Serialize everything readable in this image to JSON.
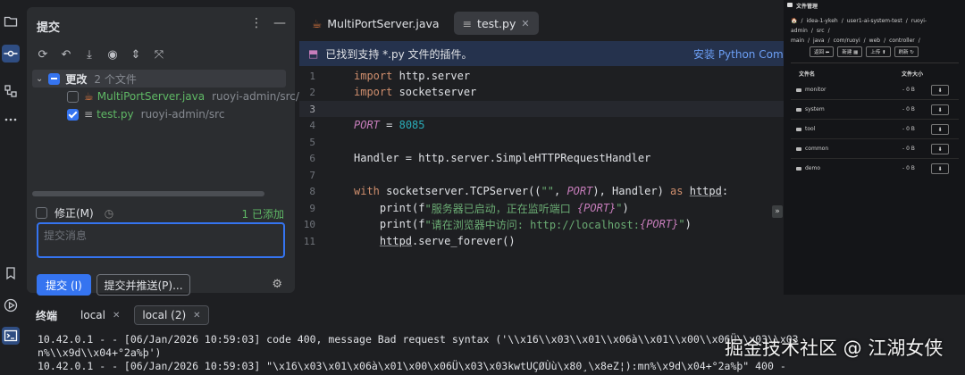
{
  "toolstrip": {
    "items": [
      "folder-icon",
      "commit-icon",
      "structure-icon",
      "more-icon"
    ],
    "bottom_items": [
      "bookmark-icon",
      "run-icon",
      "terminal-icon"
    ]
  },
  "commit_panel": {
    "title": "提交",
    "changes_label": "更改",
    "changes_count": "2 个文件",
    "files": [
      {
        "name": "MultiPortServer.java",
        "path": "ruoyi-admin/src/main",
        "checked": false
      },
      {
        "name": "test.py",
        "path": "ruoyi-admin/src",
        "checked": true
      }
    ],
    "amend_label": "修正(M)",
    "added_label": "1 已添加",
    "message_placeholder": "提交消息",
    "commit_button": "提交 (I)",
    "commit_push_button": "提交并推送(P)..."
  },
  "editor": {
    "tabs": [
      {
        "label": "MultiPortServer.java",
        "active": false
      },
      {
        "label": "test.py",
        "active": true
      }
    ],
    "notice_text": "已找到支持 *.py 文件的插件。",
    "notice_action": "安装 Python Comm",
    "line_numbers": [
      "1",
      "2",
      "3",
      "4",
      "5",
      "6",
      "7",
      "8",
      "9",
      "10",
      "11"
    ],
    "code": {
      "l1_kw": "import",
      "l1_rest": " http.server",
      "l2_kw": "import",
      "l2_rest": " socketserver",
      "l4_name": "PORT",
      "l4_eq": " = ",
      "l4_val": "8085",
      "l6_text": "Handler = http.server.SimpleHTTPRequestHandler",
      "l8_kw": "with",
      "l8_a": " socketserver.TCPServer((",
      "l8_str": "\"\"",
      "l8_b": ", ",
      "l8_port": "PORT",
      "l8_c": "), Handler) ",
      "l8_as": "as",
      "l8_sp": " ",
      "l8_var": "httpd",
      "l8_end": ":",
      "l9_a": "    print(f",
      "l9_str": "\"服务器已启动，正在监听端口 ",
      "l9_var": "{PORT}",
      "l9_end_str": "\"",
      "l9_end": ")",
      "l10_a": "    print(f",
      "l10_str": "\"请在浏览器中访问: http://localhost:",
      "l10_var": "{PORT}",
      "l10_end_str": "\"",
      "l10_end": ")",
      "l11_a": "    ",
      "l11_var": "httpd",
      "l11_rest": ".serve_forever()"
    },
    "fold_marker": "»"
  },
  "file_manager": {
    "title": "文件管理",
    "breadcrumb": [
      "🏠",
      "/",
      "idea-1-ykeh",
      "/",
      "user1-ai-system-test",
      "/",
      "ruoyi-admin",
      "/",
      "src",
      "/",
      "main",
      "/",
      "java",
      "/",
      "com/ruoyi",
      "/",
      "web",
      "/",
      "controller",
      "/"
    ],
    "buttons": [
      "返回 ⬅",
      "新建 ▦",
      "上传 ⬆",
      "刷新 ↻"
    ],
    "col_name": "文件名",
    "col_size": "文件大小",
    "rows": [
      {
        "name": "monitor",
        "size": "- 0 B"
      },
      {
        "name": "system",
        "size": "- 0 B"
      },
      {
        "name": "tool",
        "size": "- 0 B"
      },
      {
        "name": "common",
        "size": "- 0 B"
      },
      {
        "name": "demo",
        "size": "- 0 B"
      }
    ],
    "download_glyph": "⬇"
  },
  "terminal": {
    "title": "终端",
    "tabs": [
      {
        "label": "local",
        "active": false
      },
      {
        "label": "local (2)",
        "active": true
      }
    ],
    "lines": [
      "10.42.0.1 - - [06/Jan/2026 10:59:03] code 400, message Bad request syntax ('\\\\x16\\\\x03\\\\x01\\\\x06à\\\\x01\\\\x00\\\\x06Ü\\\\x03\\\\x03",
      "n%\\\\x9d\\\\x04+°2a%þ')",
      "10.42.0.1 - - [06/Jan/2026 10:59:03] \"\\x16\\x03\\x01\\x06à\\x01\\x00\\x06Ü\\x03\\x03kwtUÇØÙù\\x80¸\\x8eZ¦):mn%\\x9d\\x04+°2a%þ\" 400 -"
    ],
    "watermark": "掘金技术社区 @ 江湖女侠"
  },
  "colors": {
    "accent": "#3574f0",
    "keyword": "#cf8e6d",
    "constant": "#c77dbb",
    "number": "#2aacb8",
    "string": "#6aab73",
    "added": "#5fb865"
  }
}
